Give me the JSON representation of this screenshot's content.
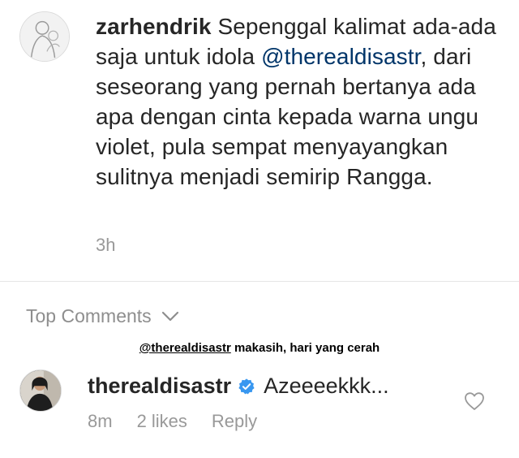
{
  "caption": {
    "username": "zarhendrik",
    "text_before_mention": " Sepenggal kalimat ada-ada saja untuk idola ",
    "mention": "@therealdisastr",
    "text_after_mention": ", dari seseorang yang pernah bertanya ada apa dengan cinta kepada warna ungu violet, pula sempat menyayangkan sulitnya menjadi semirip Rangga.",
    "timestamp": "3h"
  },
  "comments_header": {
    "label": "Top Comments",
    "icon": "chevron-down-icon"
  },
  "overlay_text": {
    "mention": "@therealdisastr",
    "message": " makasih, hari yang cerah"
  },
  "comment": {
    "username": "therealdisastr",
    "verified_icon": "verified-badge-icon",
    "text": "Azeeeekkk...",
    "timestamp": "8m",
    "likes": "2 likes",
    "reply_label": "Reply",
    "like_icon": "heart-icon"
  },
  "colors": {
    "text": "#262626",
    "muted": "#999999",
    "mention": "#003569",
    "verified": "#3897f0",
    "divider": "#e6e6e6"
  }
}
